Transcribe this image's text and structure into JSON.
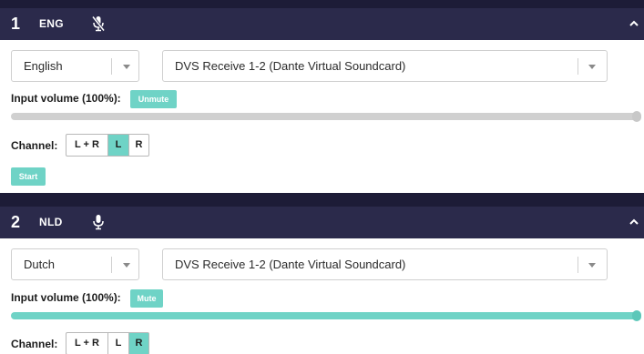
{
  "colors": {
    "header_bg": "#2b2a4b",
    "separator_bg": "#1d1c37",
    "accent": "#6fd3c6",
    "slider_off": "#d0d0d0"
  },
  "panels": [
    {
      "number": "1",
      "language_code": "ENG",
      "mic_icon": "mic-muted-icon",
      "collapse_icon": "chevron-up-icon",
      "language_select": "English",
      "device_select": "DVS Receive 1-2 (Dante Virtual Soundcard)",
      "input_volume_label": "Input volume (100%):",
      "mute_button": "Unmute",
      "volume_level": 1.0,
      "slider_active": false,
      "channel_label": "Channel:",
      "channel_options": [
        "L + R",
        "L",
        "R"
      ],
      "channel_selected": "L",
      "start_button": "Start"
    },
    {
      "number": "2",
      "language_code": "NLD",
      "mic_icon": "mic-icon",
      "collapse_icon": "chevron-up-icon",
      "language_select": "Dutch",
      "device_select": "DVS Receive 1-2 (Dante Virtual Soundcard)",
      "input_volume_label": "Input volume (100%):",
      "mute_button": "Mute",
      "volume_level": 1.0,
      "slider_active": true,
      "channel_label": "Channel:",
      "channel_options": [
        "L + R",
        "L",
        "R"
      ],
      "channel_selected": "R"
    }
  ]
}
